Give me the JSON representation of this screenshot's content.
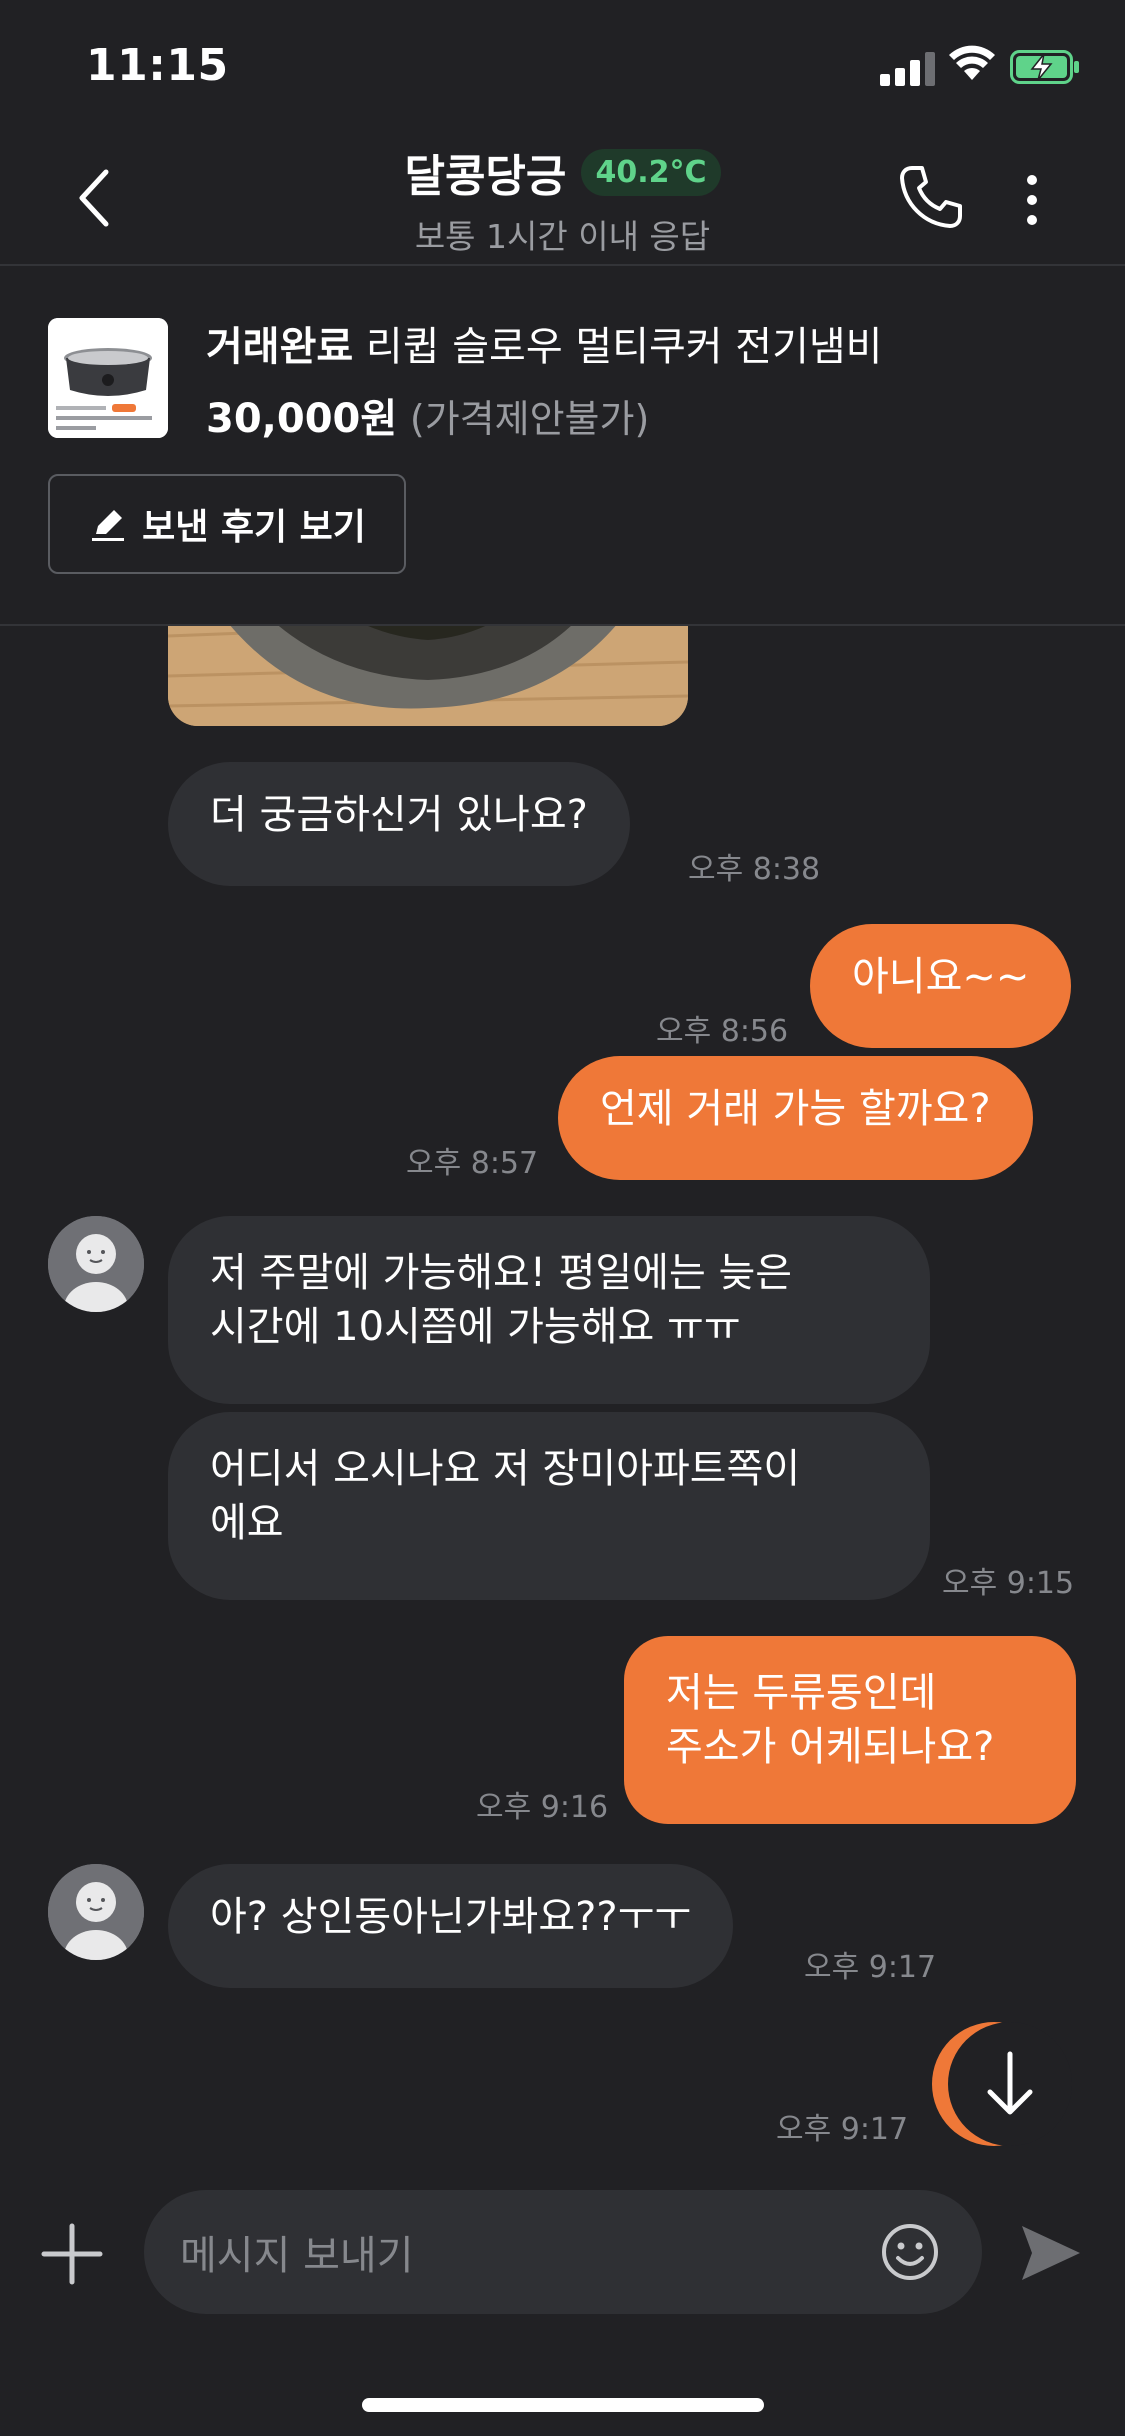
{
  "status_bar": {
    "time": "11:15"
  },
  "header": {
    "title": "달콩당긍",
    "temperature": "40.2°C",
    "subtitle": "보통 1시간 이내 응답"
  },
  "product": {
    "status": "거래완료",
    "name": "리큅 슬로우 멀티쿠커 전기냄비",
    "price": "30,000원",
    "negotiation": "(가격제안불가)",
    "review_button": "보낸 후기 보기"
  },
  "messages": [
    {
      "side": "in",
      "text": "더 궁금하신거 있나요?",
      "time": "오후 8:38"
    },
    {
      "side": "out",
      "text": "아니요~~",
      "time": "오후 8:56"
    },
    {
      "side": "out",
      "text": "언제 거래 가능 할까요?",
      "time": "오후 8:57"
    },
    {
      "side": "in",
      "text": "저 주말에 가능해요! 평일에는 늦은\n시간에 10시쯤에 가능해요 ㅠㅠ",
      "time": ""
    },
    {
      "side": "in",
      "text": "어디서 오시나요 저 장미아파트쪽이\n에요",
      "time": "오후 9:15"
    },
    {
      "side": "out",
      "text": "저는 두류동인데\n주소가 어케되나요?",
      "time": "오후 9:16"
    },
    {
      "side": "in",
      "text": "아? 상인동아닌가봐요??ㅜㅜ",
      "time": "오후 9:17"
    },
    {
      "side": "out",
      "text": "",
      "time": "오후 9:17"
    }
  ],
  "input": {
    "placeholder": "메시지 보내기"
  },
  "colors": {
    "accent": "#ef7838",
    "background": "#212124",
    "bubble_in": "#2f3034",
    "temperature": "#5fd38a"
  },
  "icons": [
    "back-icon",
    "phone-icon",
    "more-icon",
    "pencil-icon",
    "scroll-down-icon",
    "plus-icon",
    "emoji-icon",
    "send-icon"
  ]
}
